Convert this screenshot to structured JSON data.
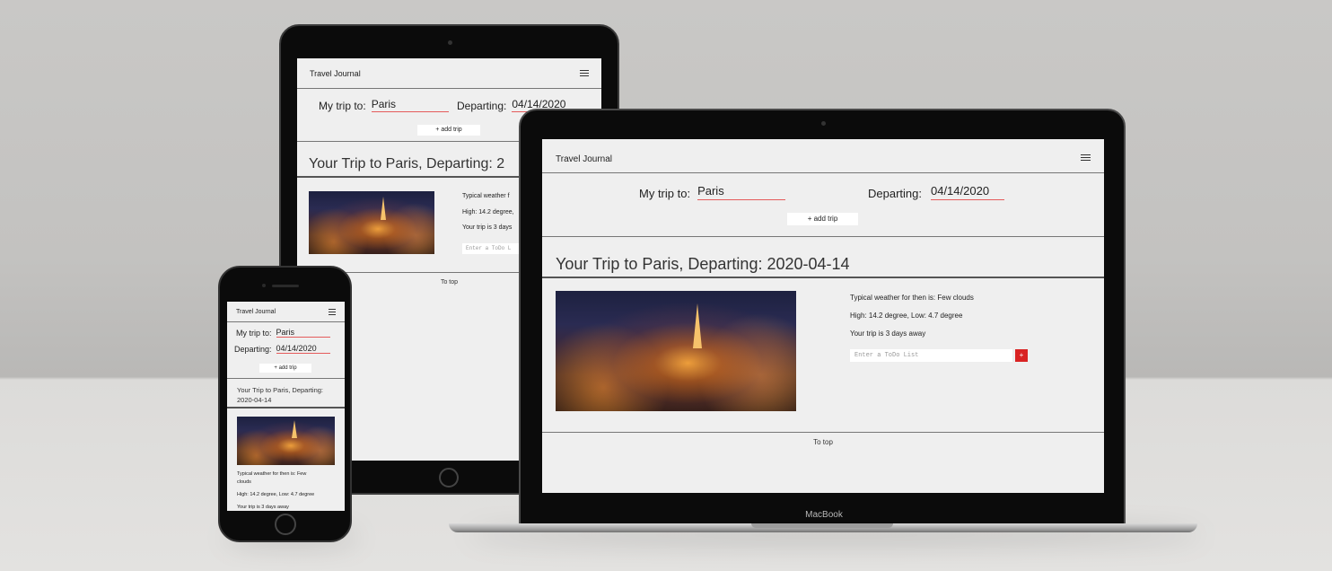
{
  "app": {
    "title": "Travel Journal",
    "form": {
      "destination_label": "My trip to:",
      "destination_value": "Paris",
      "date_label": "Departing:",
      "date_value": "04/14/2020",
      "add_button": "+ add trip"
    },
    "trip": {
      "heading": "Your Trip to Paris, Departing: 2020-04-14",
      "heading_tablet_cropped": "Your Trip to Paris, Departing: 2",
      "weather": "Typical weather for then is: Few clouds",
      "weather_tablet_cropped": "Typical weather f",
      "temps": "High: 14.2 degree, Low: 4.7 degree",
      "temps_tablet_cropped": "High: 14.2 degree,",
      "countdown": "Your trip is 3 days away",
      "countdown_tablet_cropped": "Your trip is 3 days",
      "todo_placeholder": "Enter a ToDo List",
      "todo_placeholder_tablet_cropped": "Enter a ToDo L",
      "todo_add_button": "+"
    },
    "footer_link": "To top"
  },
  "phone_trip": {
    "heading_line1": "Your Trip to Paris, Departing:",
    "heading_line2": "2020-04-14",
    "weather_line1": "Typical weather for then is: Few",
    "weather_line2": "clouds"
  },
  "laptop_brand": "MacBook",
  "colors": {
    "accent_red": "#d92323",
    "underline_red": "#e55b5b",
    "screen_bg": "#efefef"
  }
}
